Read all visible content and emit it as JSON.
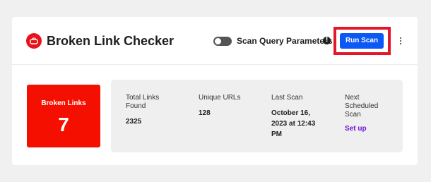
{
  "header": {
    "title": "Broken Link Checker",
    "toggle_label": "Scan Query Parameters",
    "toggle_on": false,
    "info_glyph": "!",
    "run_scan_label": "Run Scan",
    "menu_icon": "more-vertical-icon",
    "logo_icon": "broken-link-icon"
  },
  "summary": {
    "broken_label": "Broken Links",
    "broken_count": "7"
  },
  "stats": {
    "total_links_label_1": "Total Links",
    "total_links_label_2": "Found",
    "total_links_value": "2325",
    "unique_urls_label": "Unique URLs",
    "unique_urls_value": "128",
    "last_scan_label": "Last Scan",
    "last_scan_line_1": "October 16,",
    "last_scan_line_2": "2023 at 12:43",
    "last_scan_line_3": "PM",
    "next_scan_label_1": "Next",
    "next_scan_label_2": "Scheduled",
    "next_scan_label_3": "Scan",
    "next_scan_link": "Set up"
  },
  "colors": {
    "accent_blue": "#0a58f5",
    "broken_red": "#f50f00",
    "highlight_red": "#e3162a",
    "link_purple": "#6b0fd6"
  }
}
